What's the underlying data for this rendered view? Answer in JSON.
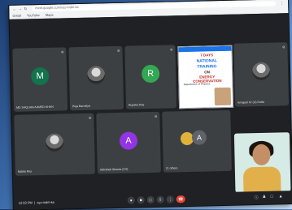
{
  "browser": {
    "url": "meet.google.com/xyz-mdm-ks",
    "bookmarks": [
      "Gmail",
      "YouTube",
      "Maps"
    ]
  },
  "participants": [
    {
      "name": "MD SAQLAIN AHMED KHAN",
      "initial": "M",
      "color": "#12734d"
    },
    {
      "name": "Puja Barodiya",
      "photo": true
    },
    {
      "name": "Rupsha Roy",
      "initial": "R",
      "color": "#33a852"
    },
    {
      "name": "Arnapari Kr (U) Dutta",
      "photo": true
    },
    {
      "name": "Nabila Roy",
      "photo": true
    },
    {
      "name": "Abhishek Biswas (CS)",
      "initial": "A",
      "color": "#9334e6"
    },
    {
      "name": "21 others",
      "initial": "A",
      "color": "#5f6368"
    }
  ],
  "presentation": {
    "line1": "7 DAYS",
    "line2": "NATIONAL",
    "line3": "TRAINING",
    "line4": "ON",
    "line5": "ENERGY CONSERVATION",
    "line6": "Department of Physics"
  },
  "bottombar": {
    "time": "12:59 PM",
    "meeting_code": "xyz-mdm-ks"
  },
  "icons": [
    "mic-icon",
    "camera-icon",
    "captions-icon",
    "present-icon",
    "more-icon",
    "end-call-icon",
    "info-icon",
    "people-icon",
    "chat-icon",
    "activities-icon"
  ]
}
